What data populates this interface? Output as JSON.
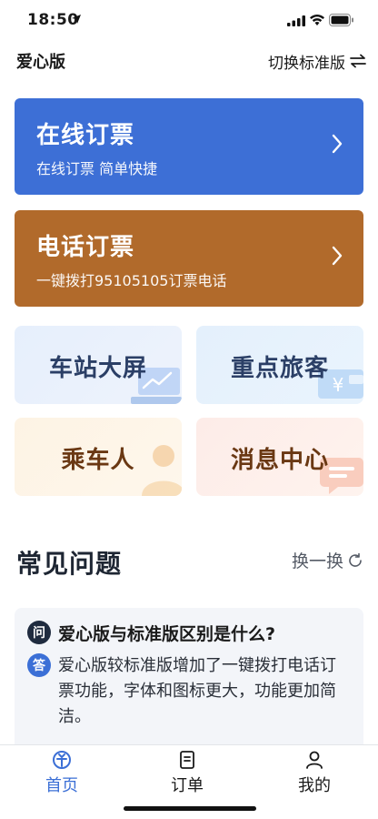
{
  "status_bar": {
    "time": "18:50"
  },
  "header": {
    "title": "爱心版",
    "switch_label": "切换标准版"
  },
  "banners": {
    "online": {
      "title": "在线订票",
      "subtitle": "在线订票 简单快捷"
    },
    "phone": {
      "title": "电话订票",
      "subtitle": "一键拨打95105105订票电话"
    }
  },
  "tiles": {
    "screen": "车站大屏",
    "vip": "重点旅客",
    "passenger": "乘车人",
    "message": "消息中心"
  },
  "faq": {
    "title": "常见问题",
    "refresh_label": "换一换",
    "q_badge": "问",
    "a_badge": "答",
    "question": "爱心版与标准版区别是什么?",
    "answer": "爱心版较标准版增加了一键拨打电话订票功能，字体和图标更大，功能更加简洁。"
  },
  "tabbar": {
    "home": "首页",
    "orders": "订单",
    "mine": "我的"
  },
  "colors": {
    "primary_blue": "#3d6fd6",
    "phone_brown": "#b16a2b",
    "active_tab": "#3b6fd6"
  },
  "icons": {
    "location": "location-arrow-icon",
    "signal": "cellular-signal-icon",
    "wifi": "wifi-icon",
    "battery": "battery-icon",
    "switch": "swap-arrows-icon",
    "chevron": "chevron-right-icon",
    "refresh": "refresh-icon",
    "home": "train-logo-icon",
    "orders": "document-icon",
    "mine": "person-icon"
  }
}
